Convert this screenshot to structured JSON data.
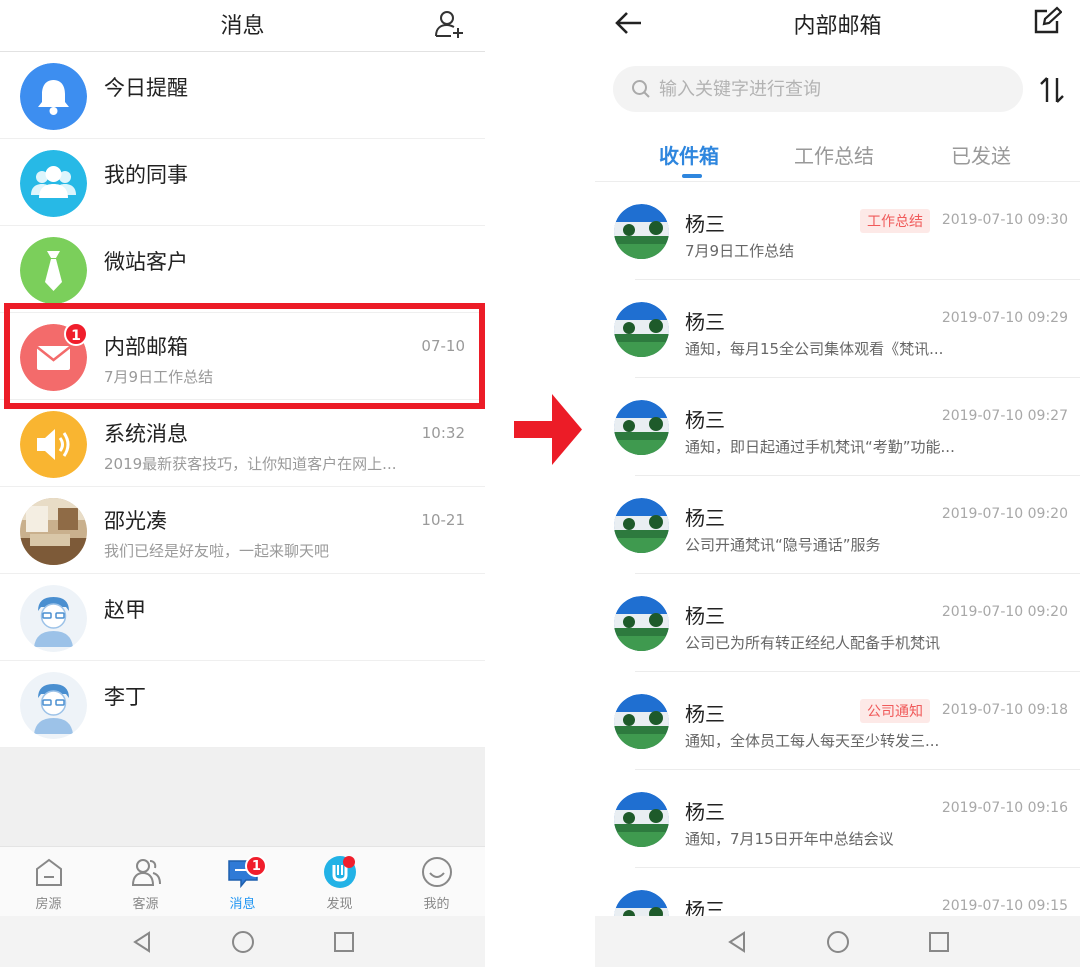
{
  "left": {
    "header": {
      "title": "消息"
    },
    "messages": [
      {
        "name": "今日提醒",
        "subtitle": "",
        "time": ""
      },
      {
        "name": "我的同事",
        "subtitle": "",
        "time": ""
      },
      {
        "name": "微站客户",
        "subtitle": "",
        "time": ""
      },
      {
        "name": "内部邮箱",
        "subtitle": "7月9日工作总结",
        "time": "07-10",
        "badge": "1"
      },
      {
        "name": "系统消息",
        "subtitle": "2019最新获客技巧，让你知道客户在网上...",
        "time": "10:32"
      },
      {
        "name": "邵光凑",
        "subtitle": "我们已经是好友啦，一起来聊天吧",
        "time": "10-21"
      },
      {
        "name": "赵甲",
        "subtitle": "",
        "time": ""
      },
      {
        "name": "李丁",
        "subtitle": "",
        "time": ""
      }
    ],
    "tabbar": [
      {
        "label": "房源",
        "icon": "house-icon"
      },
      {
        "label": "客源",
        "icon": "people-icon"
      },
      {
        "label": "消息",
        "icon": "message-icon",
        "badge": "1",
        "active": true
      },
      {
        "label": "发现",
        "icon": "discover-icon"
      },
      {
        "label": "我的",
        "icon": "smile-icon"
      }
    ]
  },
  "right": {
    "header": {
      "title": "内部邮箱"
    },
    "search": {
      "placeholder": "输入关键字进行查询"
    },
    "tabs": [
      "收件箱",
      "工作总结",
      "已发送"
    ],
    "mails": [
      {
        "sender": "杨三",
        "tag": "工作总结",
        "time": "2019-07-10 09:30",
        "preview": "7月9日工作总结"
      },
      {
        "sender": "杨三",
        "tag": "",
        "time": "2019-07-10 09:29",
        "preview": "通知，每月15全公司集体观看《梵讯..."
      },
      {
        "sender": "杨三",
        "tag": "",
        "time": "2019-07-10 09:27",
        "preview": "通知，即日起通过手机梵讯“考勤”功能..."
      },
      {
        "sender": "杨三",
        "tag": "",
        "time": "2019-07-10 09:20",
        "preview": "公司开通梵讯“隐号通话”服务"
      },
      {
        "sender": "杨三",
        "tag": "",
        "time": "2019-07-10 09:20",
        "preview": "公司已为所有转正经纪人配备手机梵讯"
      },
      {
        "sender": "杨三",
        "tag": "公司通知",
        "time": "2019-07-10 09:18",
        "preview": "通知，全体员工每人每天至少转发三..."
      },
      {
        "sender": "杨三",
        "tag": "",
        "time": "2019-07-10 09:16",
        "preview": "通知，7月15日开年中总结会议"
      },
      {
        "sender": "杨三",
        "tag": "",
        "time": "2019-07-10 09:15",
        "preview": ""
      }
    ]
  },
  "colors": {
    "accent": "#2e86de",
    "highlight": "#ec1c27",
    "badge": "#f01e2c",
    "tag_text": "#f05a5a",
    "tag_bg": "#fde9e7"
  }
}
